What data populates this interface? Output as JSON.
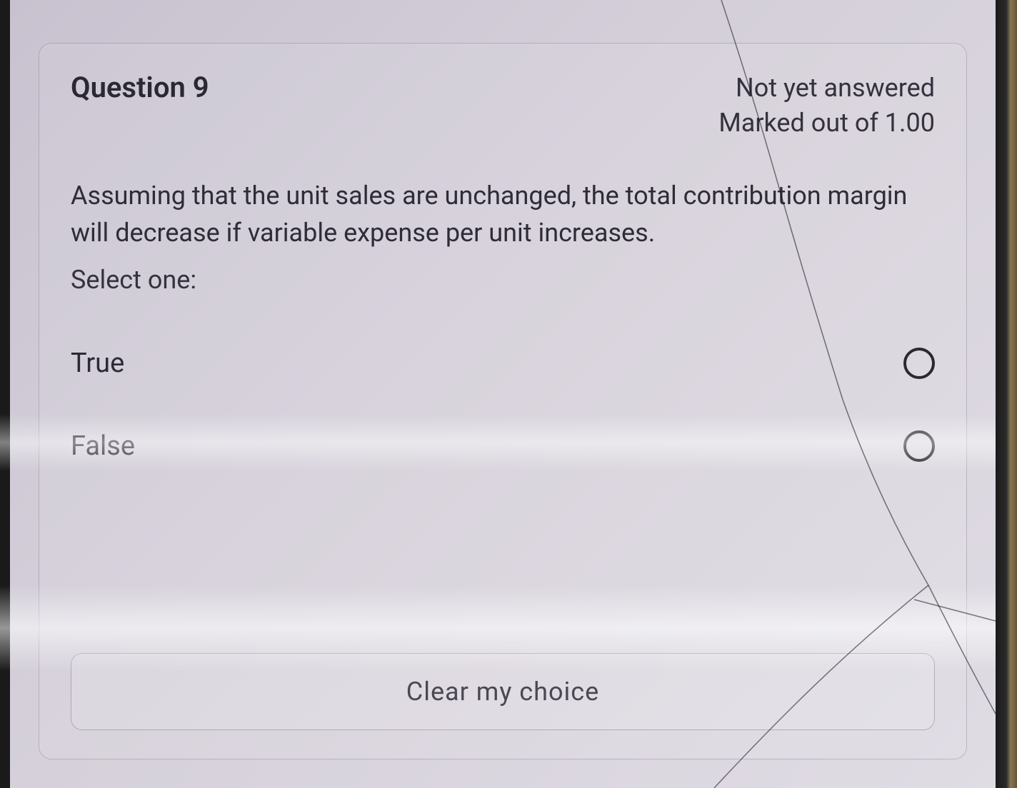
{
  "question": {
    "title": "Question 9",
    "status": "Not yet answered",
    "marks": "Marked out of 1.00",
    "text": "Assuming that the unit sales are unchanged, the total contribution margin will decrease if variable expense per unit increases.",
    "prompt": "Select one:",
    "options": [
      {
        "label": "True"
      },
      {
        "label": "False"
      }
    ],
    "clear_label": "Clear my choice"
  }
}
